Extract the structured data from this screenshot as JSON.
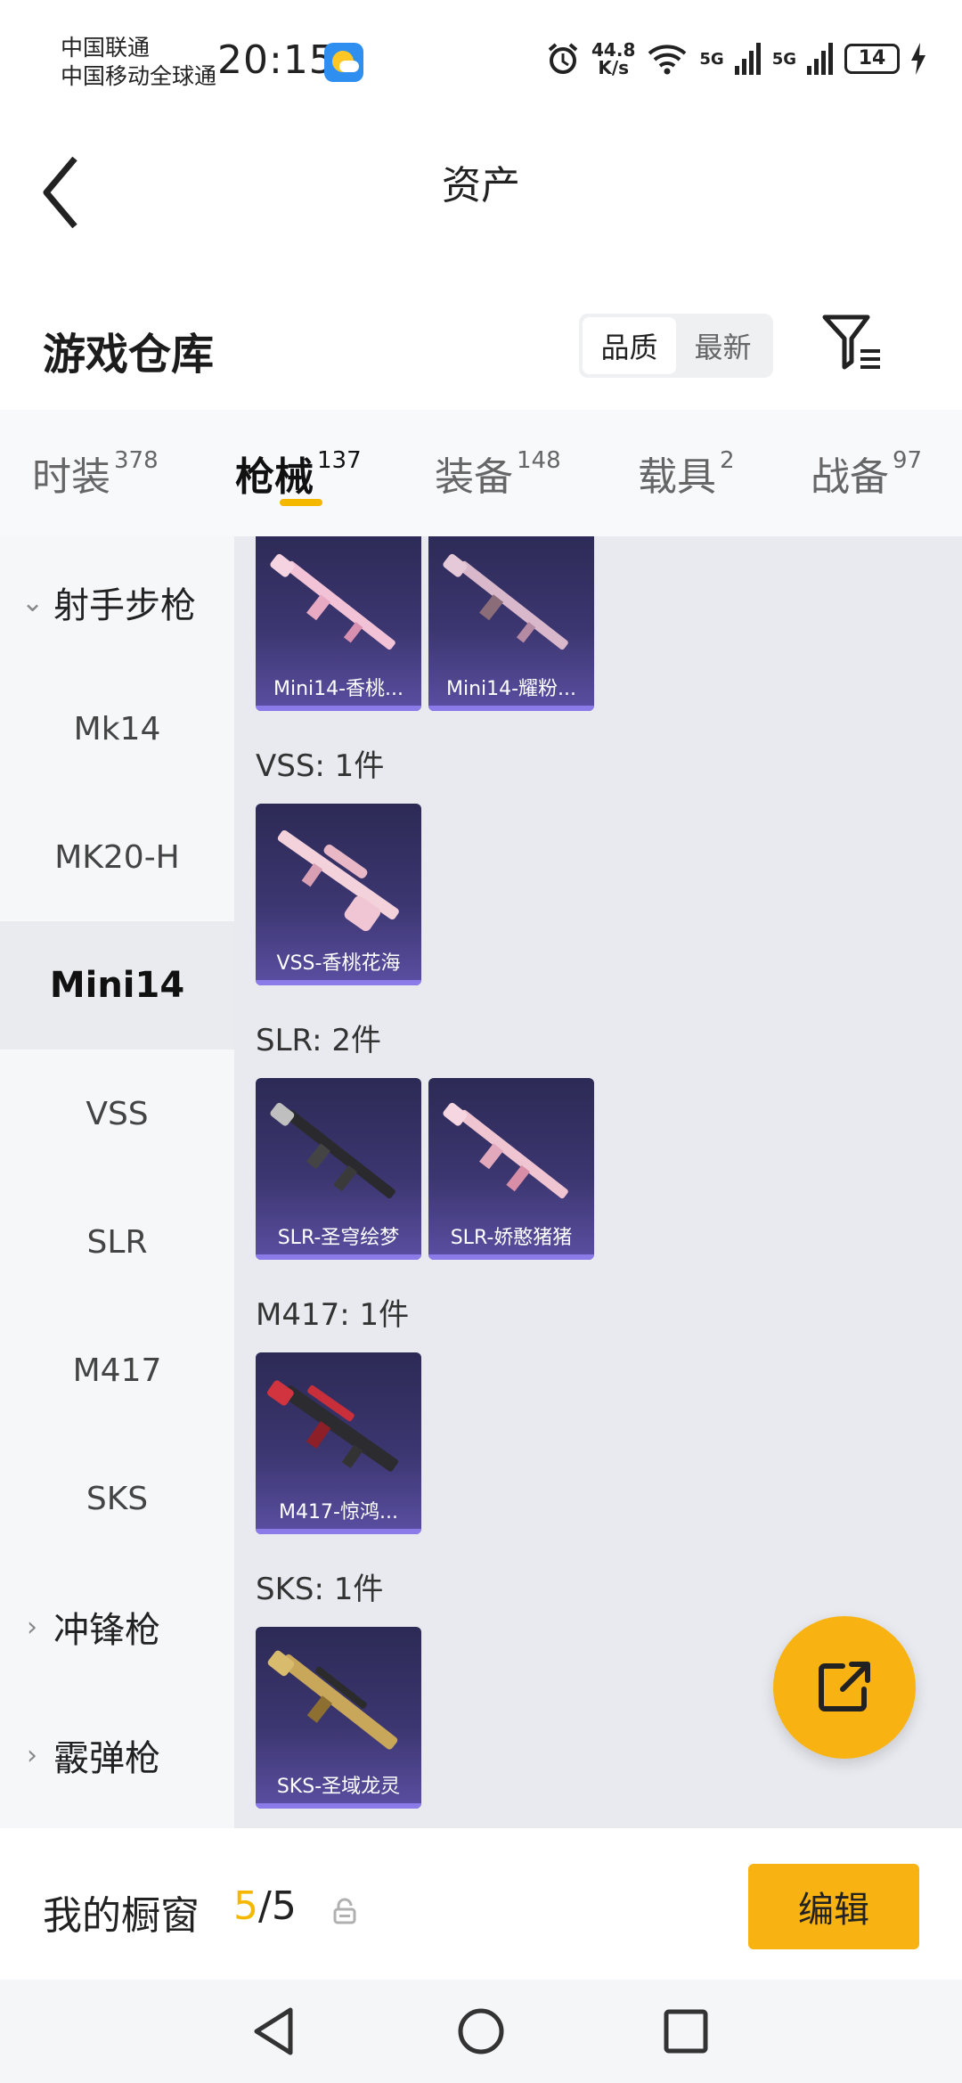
{
  "status_bar": {
    "carrier_1": "中国联通",
    "carrier_2": "中国移动全球通",
    "time": "20:15",
    "net_speed_value": "44.8",
    "net_speed_unit": "K/s",
    "signal_1": "5G",
    "signal_2": "5G",
    "battery": "14"
  },
  "header": {
    "title": "资产"
  },
  "warehouse": {
    "title": "游戏仓库",
    "sort_options": [
      "品质",
      "最新"
    ],
    "sort_selected": "品质"
  },
  "tabs": [
    {
      "label": "时装",
      "count": "378"
    },
    {
      "label": "枪械",
      "count": "137"
    },
    {
      "label": "装备",
      "count": "148"
    },
    {
      "label": "载具",
      "count": "2"
    },
    {
      "label": "战备",
      "count": "97"
    }
  ],
  "active_tab": "枪械",
  "sidebar": {
    "group_rifle": "射手步枪",
    "items": [
      "Mk14",
      "MK20-H",
      "Mini14",
      "VSS",
      "SLR",
      "M417",
      "SKS"
    ],
    "active_item": "Mini14",
    "group_smg": "冲锋枪",
    "group_shotgun": "霰弹枪"
  },
  "sections": [
    {
      "label": "",
      "items": [
        "Mini14-香桃...",
        "Mini14-耀粉..."
      ]
    },
    {
      "label": "VSS: 1件",
      "items": [
        "VSS-香桃花海"
      ]
    },
    {
      "label": "SLR: 2件",
      "items": [
        "SLR-圣穹绘梦",
        "SLR-娇憨猪猪"
      ]
    },
    {
      "label": "M417: 1件",
      "items": [
        "M417-惊鸿..."
      ]
    },
    {
      "label": "SKS: 1件",
      "items": [
        "SKS-圣域龙灵"
      ]
    }
  ],
  "bottom_bar": {
    "showcase_label": "我的橱窗",
    "showcase_current": "5",
    "showcase_total": "/5",
    "edit_label": "编辑"
  },
  "colors": {
    "accent": "#f8b312",
    "card_bg": "#3c3670"
  },
  "icons": {
    "back": "chevron-left-icon",
    "filter": "filter-icon",
    "share": "share-icon",
    "lock": "lock-icon"
  }
}
